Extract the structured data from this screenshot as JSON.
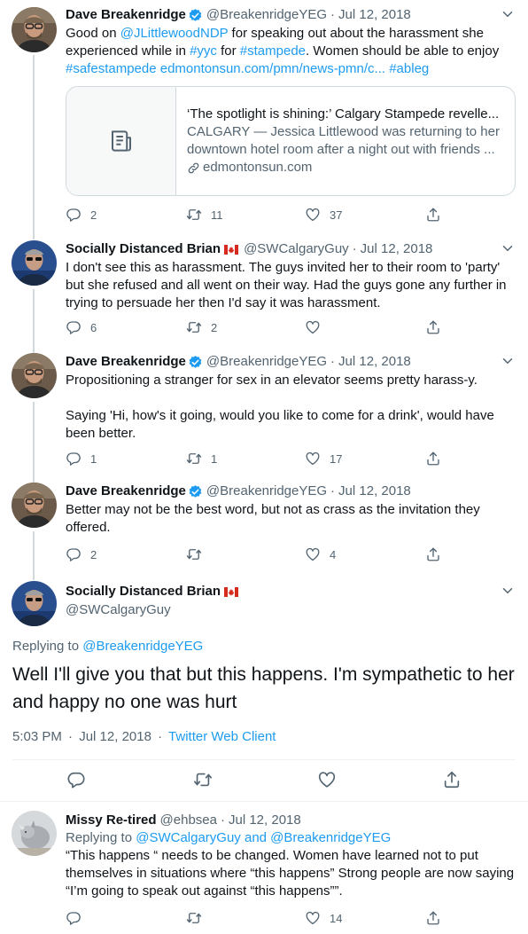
{
  "tweets": [
    {
      "name": "Dave Breakenridge",
      "handle": "@BreakenridgeYEG",
      "sep": "·",
      "date": "Jul 12, 2018",
      "text_parts": [
        "Good on ",
        "@JLittlewoodNDP",
        " for speaking out about the harassment she experienced while in ",
        "#yyc",
        " for ",
        "#stampede",
        ". Women should be able to enjoy ",
        "#safestampede",
        " ",
        "edmontonsun.com/pmn/news-pmn/c...",
        " ",
        "#ableg"
      ],
      "card": {
        "title": "‘The spotlight is shining:’ Calgary Stampede revelle...",
        "description": "CALGARY — Jessica Littlewood was returning to her downtown hotel room after a night out with friends ...",
        "domain": "edmontonsun.com"
      },
      "replies": "2",
      "retweets": "11",
      "likes": "37"
    },
    {
      "name": "Socially Distanced Brian",
      "handle": "@SWCalgaryGuy",
      "sep": "·",
      "date": "Jul 12, 2018",
      "text": "I don't see this as harassment. The guys invited her to their room to 'party' but she refused and all went on their way. Had the guys gone any further in trying to persuade her then I'd say it was harassment.",
      "replies": "6",
      "retweets": "2",
      "likes": ""
    },
    {
      "name": "Dave Breakenridge",
      "handle": "@BreakenridgeYEG",
      "sep": "·",
      "date": "Jul 12, 2018",
      "text_line1": "Propositioning a stranger for sex in an elevator seems pretty harass-y.",
      "text_line2": "Saying 'Hi, how's it going, would you like to come for a drink', would have been better.",
      "replies": "1",
      "retweets": "1",
      "likes": "17"
    },
    {
      "name": "Dave Breakenridge",
      "handle": "@BreakenridgeYEG",
      "sep": "·",
      "date": "Jul 12, 2018",
      "text": "Better may not be the best word, but not as crass as the invitation they offered.",
      "replies": "2",
      "retweets": "",
      "likes": "4"
    }
  ],
  "focused": {
    "name": "Socially Distanced Brian",
    "handle": "@SWCalgaryGuy",
    "replying_prefix": "Replying to ",
    "replying_handle": "@BreakenridgeYEG",
    "text": "Well I'll give you that but this happens. I'm sympathetic to her and happy no one was hurt",
    "time": "5:03 PM",
    "sep": "·",
    "date": "Jul 12, 2018",
    "client": "Twitter Web Client"
  },
  "reply": {
    "name": "Missy Re-tired",
    "handle": "@ehbsea",
    "sep": "·",
    "date": "Jul 12, 2018",
    "replying_prefix": "Replying to ",
    "replying_handles": "@SWCalgaryGuy and @BreakenridgeYEG",
    "text": "“This happens “ needs to be changed. Women have learned not to put themselves in situations where “this happens” Strong people are now saying “I’m going to speak out against “this happens””.",
    "replies": "",
    "retweets": "",
    "likes": "14"
  },
  "colors": {
    "accent": "#1d9bf0",
    "muted": "#536471",
    "border": "#cfd9de",
    "flag_red": "#d52b1e"
  },
  "icons": [
    "verified-badge-icon",
    "canada-flag-icon",
    "chevron-down-icon",
    "reply-icon",
    "retweet-icon",
    "like-icon",
    "share-icon",
    "article-icon",
    "link-icon"
  ]
}
